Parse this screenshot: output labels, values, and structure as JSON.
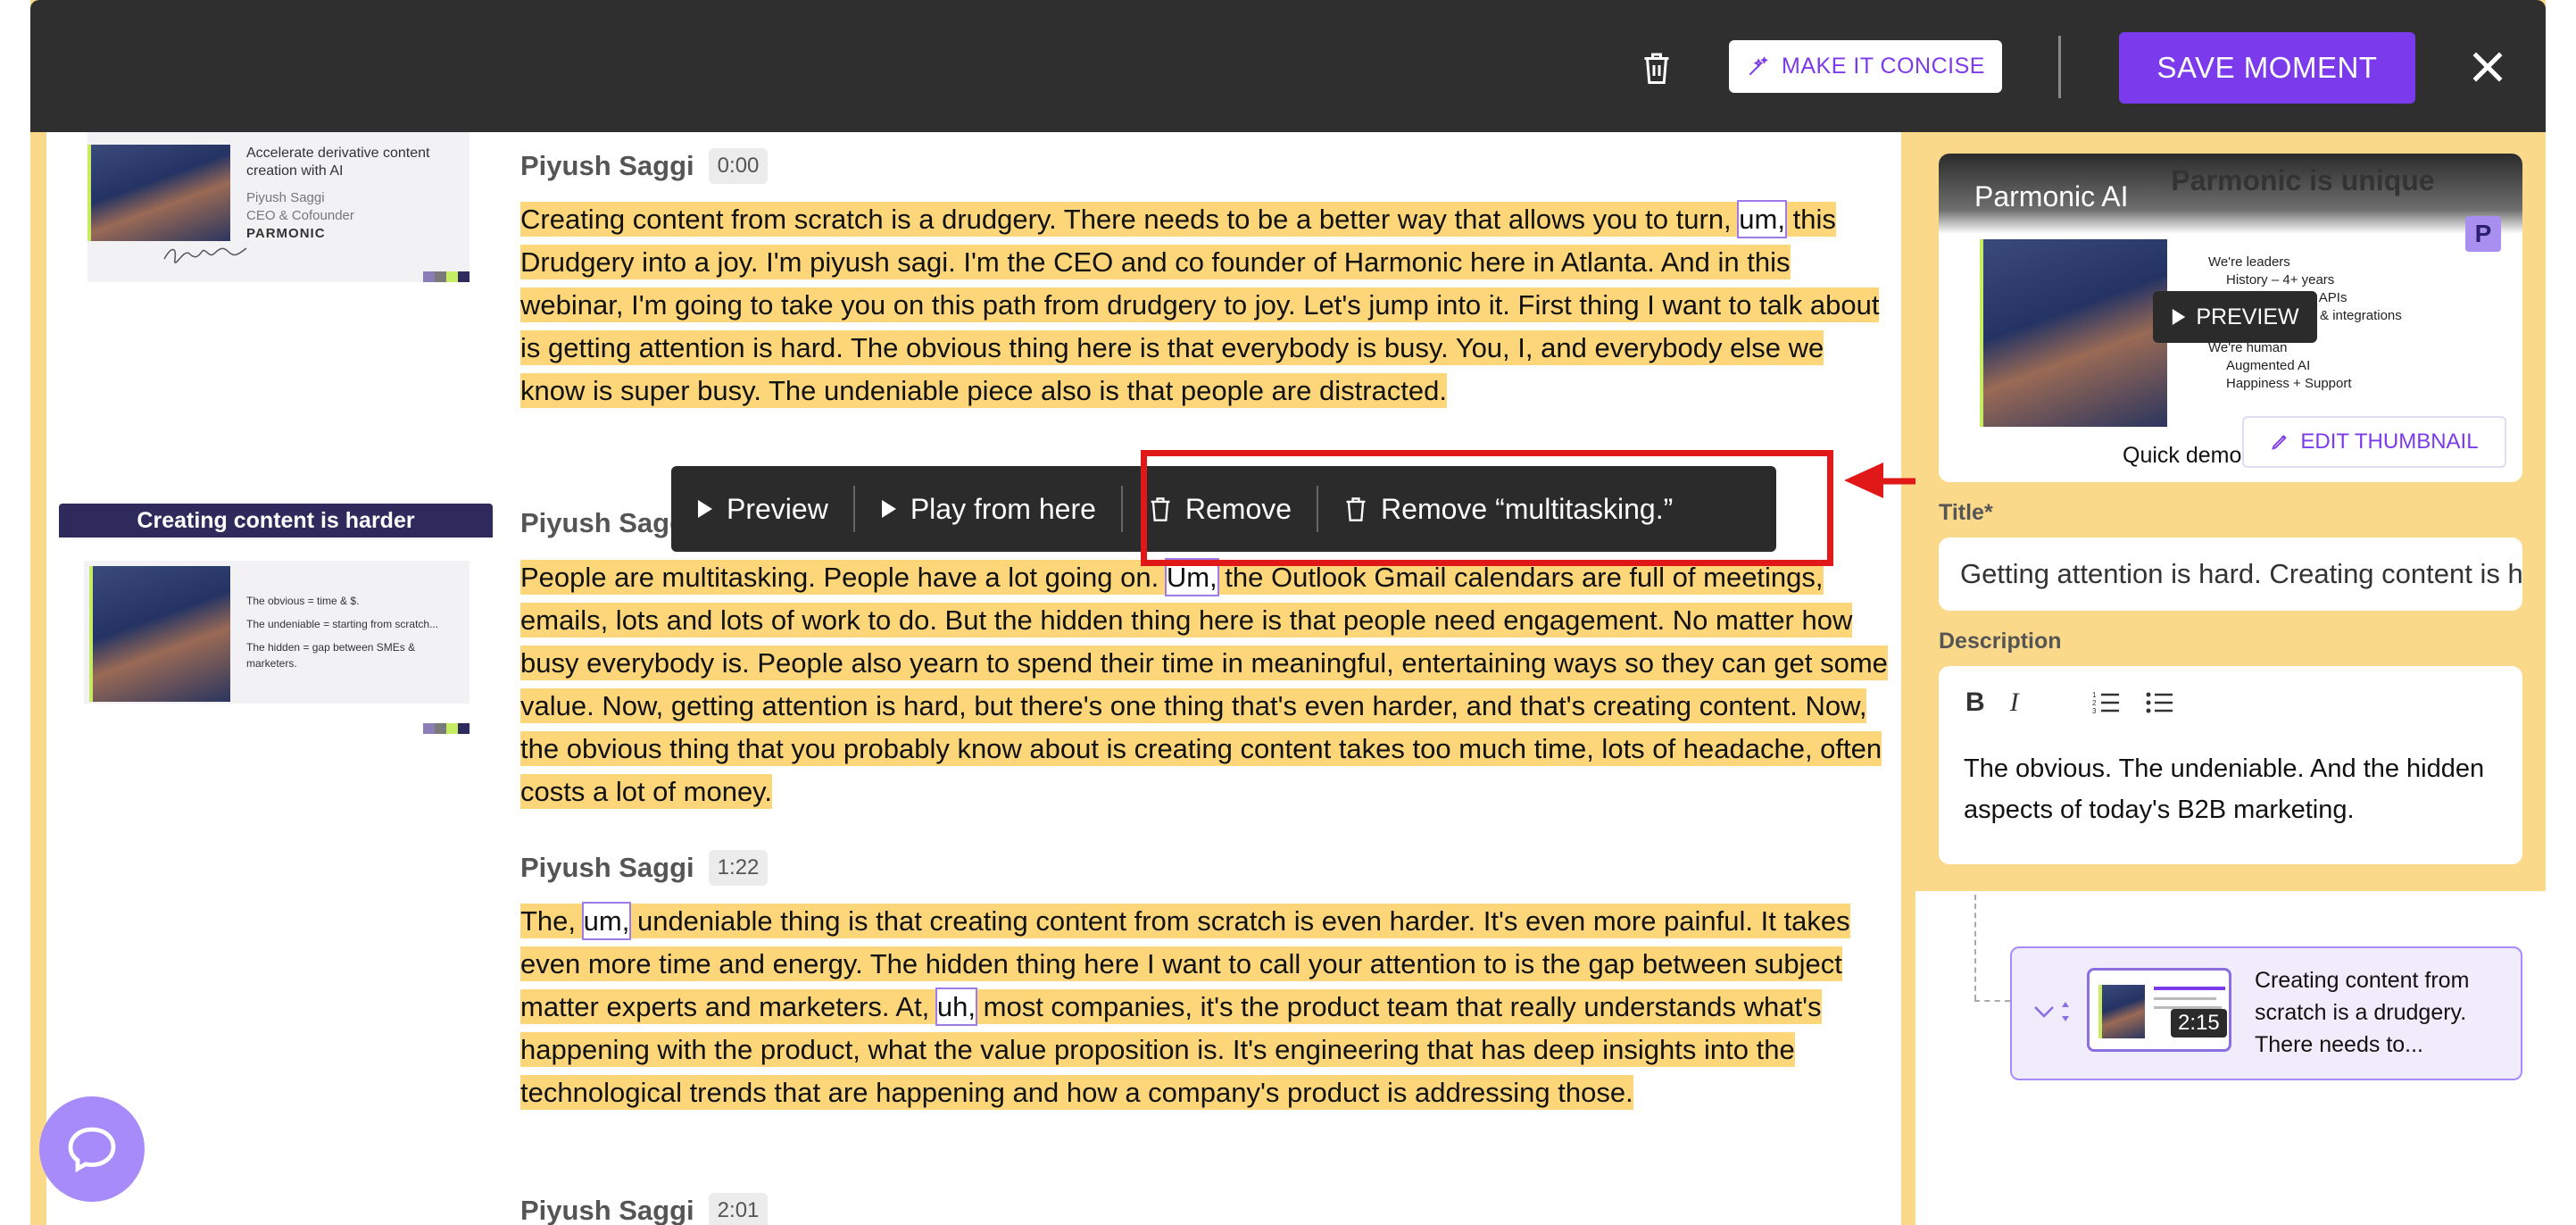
{
  "toolbar": {
    "concise_label": "MAKE IT CONCISE",
    "save_label": "SAVE MOMENT"
  },
  "thumbnails": {
    "slide1_lines": [
      "Accelerate derivative content",
      "creation with AI",
      "Piyush Saggi",
      "CEO & Cofounder",
      "PARMONIC"
    ],
    "slide2_title": "Creating content is harder",
    "slide2_lines": [
      "The obvious = time & $.",
      "The undeniable = starting from scratch...",
      "The hidden = gap between SMEs &",
      "marketers."
    ]
  },
  "transcript": [
    {
      "speaker": "Piyush Saggi",
      "time": "0:00",
      "segments": [
        {
          "t": "Creating content from scratch is a drudgery. There needs to be a better way that allows you to turn, "
        },
        {
          "t": "um,",
          "filler": true
        },
        {
          "t": " this Drudgery into a joy. I'm piyush sagi. I'm the CEO and co founder of Harmonic here in Atlanta. And in this webinar, I'm going to take you on this path from drudgery to joy. Let's jump into it. First thing I want to talk about is getting attention is hard. The obvious thing here is that everybody is busy. You, I, and everybody else we know is super busy. The undeniable piece also is that people are distracted."
        }
      ]
    },
    {
      "speaker": "Piyush Sagg",
      "time": "",
      "segments": [
        {
          "t": "People are multitasking. People have a lot going on. "
        },
        {
          "t": "Um,",
          "filler": true
        },
        {
          "t": " the Outlook Gmail calendars are full of meetings, emails, lots and lots of work to do. But the hidden thing here is that people need engagement. No matter how busy everybody is. People also yearn to spend their time in meaningful, entertaining ways so they can get some value. Now, getting attention is hard, but there's one thing that's even harder, and that's creating content. Now, the obvious thing that you probably know about is creating content takes too much time, lots of headache, often costs a lot of money."
        }
      ]
    },
    {
      "speaker": "Piyush Saggi",
      "time": "1:22",
      "segments": [
        {
          "t": "The, "
        },
        {
          "t": "um,",
          "filler": true
        },
        {
          "t": " undeniable thing is that creating content from scratch is even harder. It's even more painful. It takes even more time and energy. The hidden thing here I want to call your attention to is the gap between subject matter experts and marketers. At, "
        },
        {
          "t": "uh,",
          "filler": true
        },
        {
          "t": " most companies, it's the product team that really understands what's happening with the product, what the value proposition is. It's engineering that has deep insights into the technological trends that are happening and how a company's product is addressing those."
        }
      ]
    },
    {
      "speaker": "Piyush Saggi",
      "time": "2:01",
      "segments": []
    }
  ],
  "context_menu": {
    "preview": "Preview",
    "play_from_here": "Play from here",
    "remove": "Remove",
    "remove_word": "Remove “multitasking.”"
  },
  "thumbnail_card": {
    "brand": "Parmonic AI",
    "slide_heading": "Parmonic is unique",
    "badge": "P",
    "bullets": [
      "We're leaders",
      "History – 4+ years",
      "Original work + APIs",
      "Native platform & integrations",
      "We're human",
      "Augmented AI",
      "Happiness + Support"
    ],
    "preview_label": "PREVIEW",
    "caption": "Quick demo",
    "edit_label": "EDIT THUMBNAIL"
  },
  "form": {
    "title_label": "Title*",
    "title_value": "Getting attention is hard. Creating content is harder",
    "description_label": "Description",
    "description_value": "The obvious. The undeniable. And the hidden aspects of today's B2B marketing."
  },
  "clip": {
    "duration": "2:15",
    "text": "Creating content from scratch is a drudgery. There needs to..."
  },
  "colors": {
    "accent": "#7c3aed",
    "highlight": "#fdd67a",
    "topbar": "#2f2f2f",
    "annotation": "#e01818"
  }
}
